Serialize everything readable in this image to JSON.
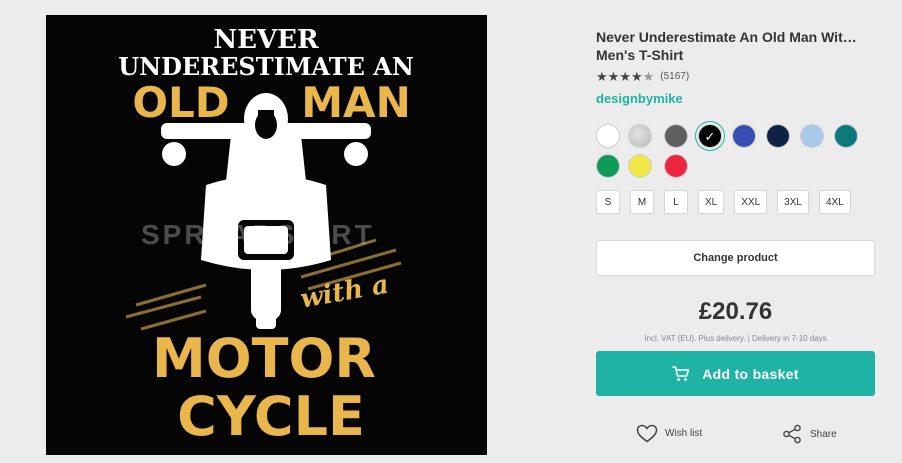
{
  "product": {
    "title_line1": "Never Underestimate An Old Man Wit…",
    "title_line2": "Men's T-Shirt",
    "review_count": "(5167)",
    "rating": 4.5,
    "designer": "designbymike",
    "image": {
      "text_never": "NEVER",
      "text_underestimate": "UNDERESTIMATE AN",
      "text_old": "OLD",
      "text_man": "MAN",
      "text_with": "with a",
      "text_motor": "MOTOR",
      "text_cycle": "CYCLE",
      "watermark": "SPREADSHIRT"
    }
  },
  "colors": [
    {
      "name": "white",
      "hex": "#ffffff"
    },
    {
      "name": "heather-grey",
      "hex": "#c9c9c9"
    },
    {
      "name": "dark-grey",
      "hex": "#5f5f5f"
    },
    {
      "name": "black",
      "hex": "#000000",
      "selected": true
    },
    {
      "name": "royal-blue",
      "hex": "#3550b0"
    },
    {
      "name": "navy",
      "hex": "#0f2147"
    },
    {
      "name": "light-blue",
      "hex": "#a7c9ea"
    },
    {
      "name": "teal",
      "hex": "#0c7a7d"
    },
    {
      "name": "kelly-green",
      "hex": "#0e9a57"
    },
    {
      "name": "yellow",
      "hex": "#f3e649"
    },
    {
      "name": "red",
      "hex": "#ee2541"
    }
  ],
  "sizes": [
    "S",
    "M",
    "L",
    "XL",
    "XXL",
    "3XL",
    "4XL"
  ],
  "actions": {
    "change_product": "Change product",
    "price": "£20.76",
    "price_note": "Incl. VAT (EU). Plus delivery. | Delivery in 7-10 days",
    "add_to_basket": "Add to basket",
    "wish_list": "Wish list",
    "share": "Share"
  },
  "theme": {
    "accent": "#1fb3a6",
    "print_yellow": "#e8b64a"
  }
}
